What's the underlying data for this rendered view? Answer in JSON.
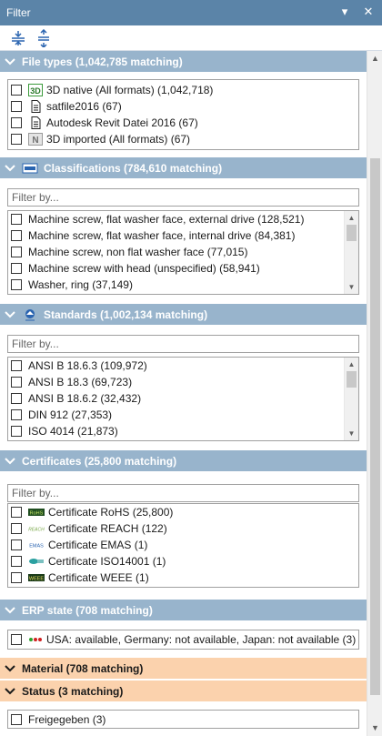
{
  "window": {
    "title": "Filter",
    "pin_glyph": "▾",
    "close_glyph": "✕"
  },
  "toolbar": {
    "expand_all_icon": "expand-all-icon",
    "collapse_all_icon": "collapse-all-icon"
  },
  "sections": {
    "file_types": {
      "title": "File types (1,042,785 matching)",
      "items": [
        {
          "icon": "3d-native-icon",
          "label": "3D native (All formats) (1,042,718)"
        },
        {
          "icon": "document-icon",
          "label": "satfile2016 (67)"
        },
        {
          "icon": "document-icon",
          "label": "Autodesk Revit Datei 2016 (67)"
        },
        {
          "icon": "3d-imported-icon",
          "label": "3D imported (All formats) (67)"
        }
      ]
    },
    "classifications": {
      "title": "Classifications (784,610 matching)",
      "filter_placeholder": "Filter by...",
      "items": [
        "Machine screw, flat washer face, external drive (128,521)",
        "Machine screw, flat washer face, internal drive (84,381)",
        "Machine screw, non flat washer face (77,015)",
        "Machine screw with head (unspecified) (58,941)",
        "Washer, ring (37,149)"
      ]
    },
    "standards": {
      "title": "Standards (1,002,134 matching)",
      "filter_placeholder": "Filter by...",
      "items": [
        "ANSI B 18.6.3 (109,972)",
        "ANSI B 18.3 (69,723)",
        "ANSI B 18.6.2 (32,432)",
        "DIN 912 (27,353)",
        "ISO 4014 (21,873)"
      ]
    },
    "certificates": {
      "title": "Certificates (25,800 matching)",
      "filter_placeholder": "Filter by...",
      "items": [
        {
          "logo": "RoHS",
          "label": "Certificate RoHS (25,800)"
        },
        {
          "logo": "REACH",
          "label": "Certificate REACH (122)"
        },
        {
          "logo": "EMAS",
          "label": "Certificate EMAS (1)"
        },
        {
          "logo": "ISO",
          "label": "Certificate ISO14001 (1)"
        },
        {
          "logo": "WEEE",
          "label": "Certificate WEEE (1)"
        }
      ]
    },
    "erp_state": {
      "title": "ERP state (708 matching)",
      "items": [
        "USA: available, Germany: not available, Japan: not available (3)"
      ]
    },
    "material": {
      "title": "Material (708 matching)"
    },
    "status": {
      "title": "Status (3 matching)",
      "items": [
        "Freigegeben (3)"
      ]
    }
  },
  "colors": {
    "title_bar": "#5b84a8",
    "section_header": "#98b4cc",
    "highlight_header": "#fbd2ad"
  }
}
